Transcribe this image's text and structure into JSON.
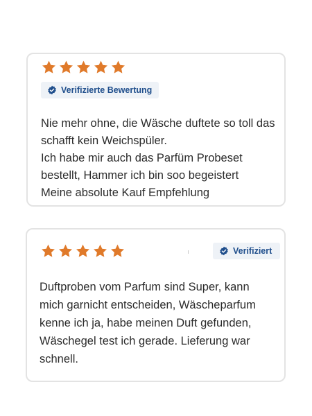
{
  "colors": {
    "star": "#e07a2a",
    "badge_text": "#1f4e8c",
    "badge_bg": "#eef2f7",
    "card_border": "#e3e3e3"
  },
  "reviews": [
    {
      "rating": 5,
      "rating_max": 5,
      "badge_icon": "verified-check-icon",
      "badge_label": "Verifizierte Bewertung",
      "lines": [
        "Nie mehr ohne, die Wäsche duftete so toll das",
        "schafft kein Weichspüler.",
        "Ich habe mir auch das Parfüm Probeset",
        "bestellt, Hammer ich bin soo begeistert",
        "Meine absolute Kauf Empfehlung"
      ]
    },
    {
      "rating": 5,
      "rating_max": 5,
      "badge_icon": "verified-check-icon",
      "badge_label": "Verifiziert",
      "lines": [
        "Duftproben vom Parfum sind Super, kann",
        "mich garnicht entscheiden, Wäscheparfum",
        "kenne ich ja, habe meinen Duft gefunden,",
        "Wäschegel test ich gerade. Lieferung war",
        "schnell."
      ]
    }
  ]
}
